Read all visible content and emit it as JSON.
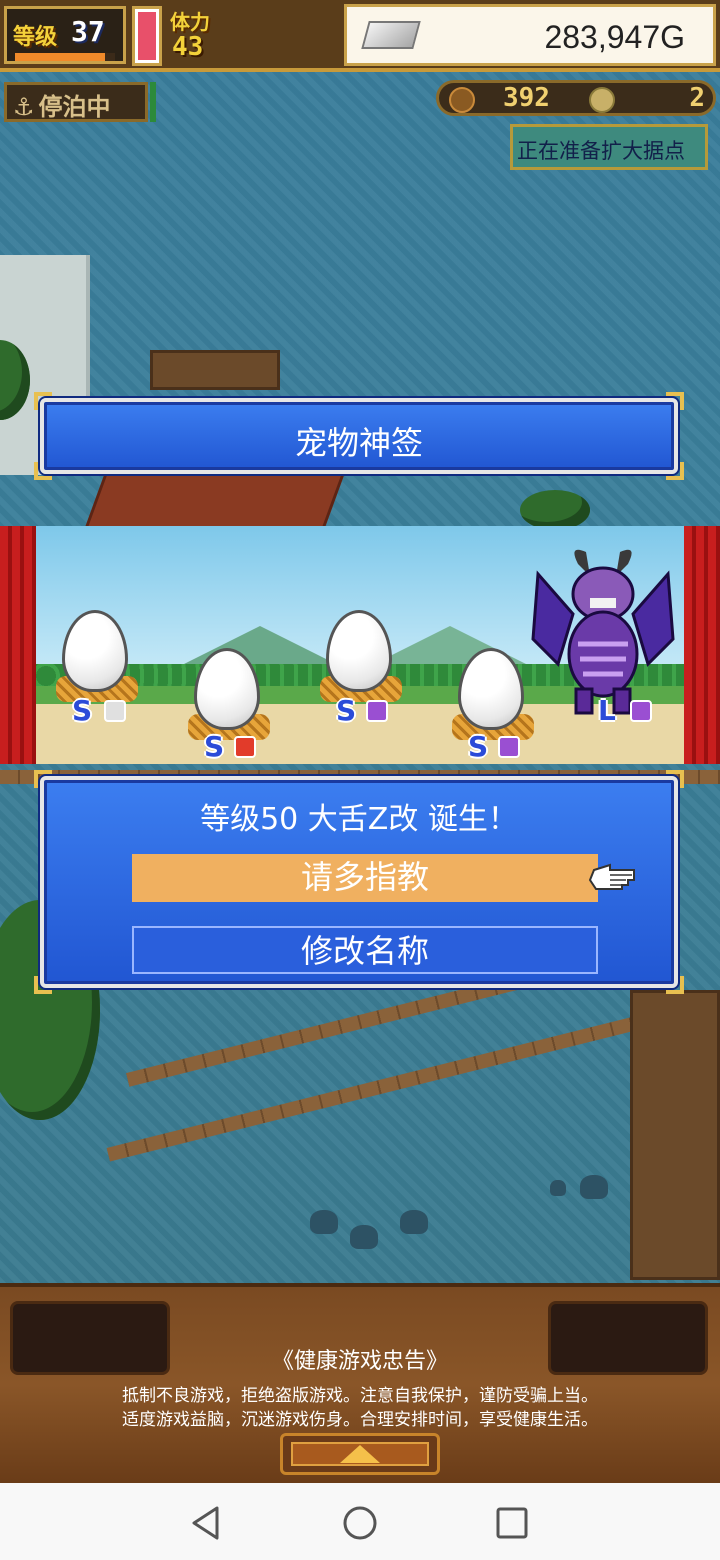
{
  "hud": {
    "level_label": "等级",
    "level_value": "37",
    "level_progress": 0.9,
    "stamina_label": "体力",
    "stamina_value": "43",
    "gold_value": "283,947G",
    "status_label": "停泊中",
    "resource_a": "392",
    "resource_b": "2",
    "notice": "正在准备扩大据点"
  },
  "dialog": {
    "title": "宠物神签",
    "result_message": "等级50 大舌Z改 诞生！",
    "option_confirm": "请多指教",
    "option_rename": "修改名称"
  },
  "scene": {
    "eggs": [
      {
        "rank": "S",
        "chip_color": "#e0e0e0"
      },
      {
        "rank": "S",
        "chip_color": "#e23b2a"
      },
      {
        "rank": "S",
        "chip_color": "#9a4fd2"
      },
      {
        "rank": "S",
        "chip_color": "#9a4fd2"
      }
    ],
    "monster_rank": "L",
    "monster_chip_color": "#9a4fd2"
  },
  "advisory": {
    "title": "《健康游戏忠告》",
    "line1": "抵制不良游戏，拒绝盗版游戏。注意自我保护，谨防受骗上当。",
    "line2": "适度游戏益脑，沉迷游戏伤身。合理安排时间，享受健康生活。"
  },
  "colors": {
    "panel_blue": "#2c66e0",
    "selected_option": "#f0b060",
    "gold_text": "#f4d23a"
  },
  "icons": {
    "anchor": "anchor-icon",
    "silver": "silver-bar-icon",
    "pointer": "hand-pointer-icon",
    "back": "nav-back-icon",
    "home": "nav-home-icon",
    "recents": "nav-recents-icon"
  }
}
